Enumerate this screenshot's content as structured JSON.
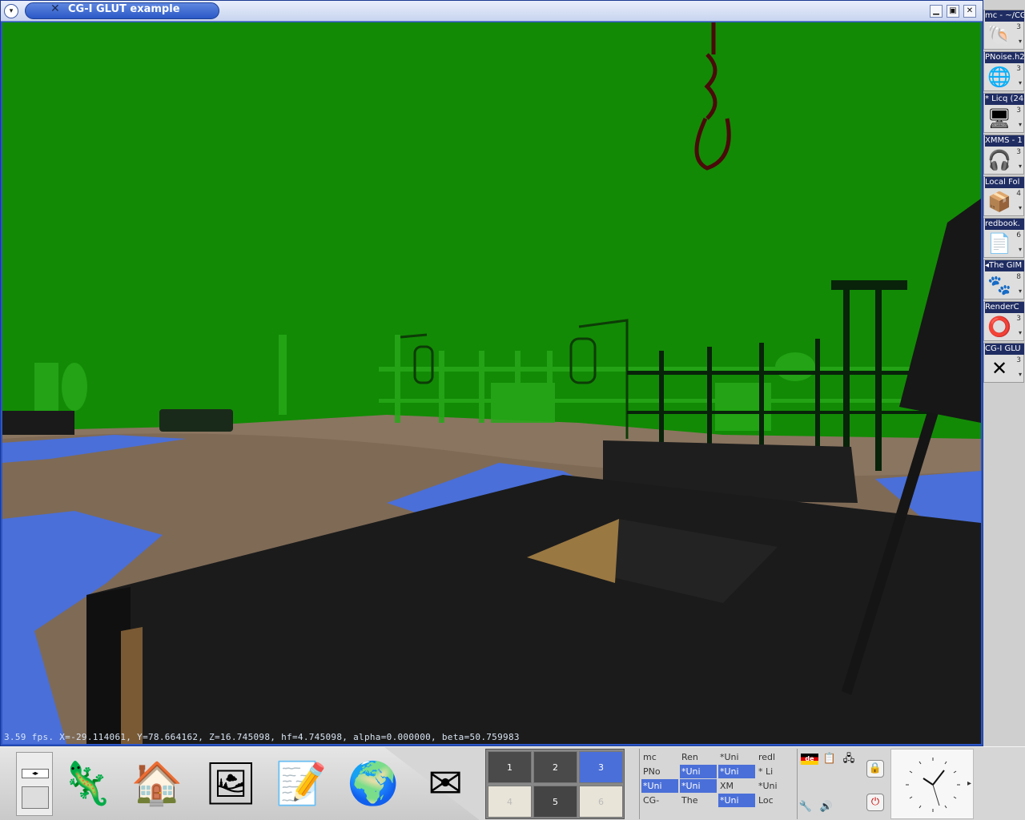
{
  "window": {
    "title": "CG-I GLUT example",
    "menu_glyph": "▾",
    "minimize_glyph": "▁",
    "maximize_glyph": "▣",
    "close_glyph": "✕"
  },
  "hud": {
    "text": "3.59 fps.  X=-29.114061, Y=78.664162, Z=16.745098, hf=4.745098, alpha=0.000000, beta=50.759983"
  },
  "sidebar": {
    "items": [
      {
        "label": "mc - ~/CG",
        "icon": "🐚",
        "num": "3",
        "icon_name": "shell-icon"
      },
      {
        "label": "PNoise.h2",
        "icon": "🌐",
        "num": "3",
        "icon_name": "browser-icon"
      },
      {
        "label": "* Licq (24",
        "icon": "🖥",
        "num": "3",
        "icon_name": "computer-icon"
      },
      {
        "label": "XMMS - 1",
        "icon": "🎧",
        "num": "3",
        "icon_name": "headphones-icon"
      },
      {
        "label": "Local Fol",
        "icon": "📦",
        "num": "4",
        "icon_name": "package-icon"
      },
      {
        "label": "redbook.",
        "icon": "📄",
        "num": "6",
        "icon_name": "document-icon"
      },
      {
        "label": "◂The GIM",
        "icon": "🐾",
        "num": "8",
        "icon_name": "gimp-icon"
      },
      {
        "label": "RenderC",
        "icon": "⭕",
        "num": "3",
        "icon_name": "ring-icon"
      },
      {
        "label": "CG-I GLU",
        "icon": "✕",
        "num": "3",
        "icon_name": "x-window-icon"
      }
    ]
  },
  "panel": {
    "launchers": [
      {
        "icon": "🦎",
        "name": "suse-launcher-icon"
      },
      {
        "icon": "🏠",
        "name": "home-launcher-icon"
      },
      {
        "icon": "🖼",
        "name": "desktop-launcher-icon"
      },
      {
        "icon": "📝",
        "name": "editor-launcher-icon"
      },
      {
        "icon": "🌍",
        "name": "web-launcher-icon"
      },
      {
        "icon": "✉",
        "name": "mail-launcher-icon"
      }
    ],
    "pager": [
      "1",
      "2",
      "3",
      "4",
      "5",
      "6"
    ],
    "active_desktop": "3",
    "tasks": [
      {
        "label": "mc",
        "active": false
      },
      {
        "label": "Ren",
        "active": false
      },
      {
        "label": "*Uni",
        "active": false
      },
      {
        "label": "redl",
        "active": false
      },
      {
        "label": "PNo",
        "active": false
      },
      {
        "label": "*Uni",
        "active": true
      },
      {
        "label": "*Uni",
        "active": true
      },
      {
        "label": "* Li",
        "active": false
      },
      {
        "label": "*Uni",
        "active": true
      },
      {
        "label": "*Uni",
        "active": true
      },
      {
        "label": "XM",
        "active": false
      },
      {
        "label": "*Uni",
        "active": false
      },
      {
        "label": "CG-",
        "active": false
      },
      {
        "label": "The",
        "active": false
      },
      {
        "label": "*Uni",
        "active": true
      },
      {
        "label": "Loc",
        "active": false
      }
    ],
    "tray_flag": "de",
    "accent": "#4a6fd8"
  }
}
